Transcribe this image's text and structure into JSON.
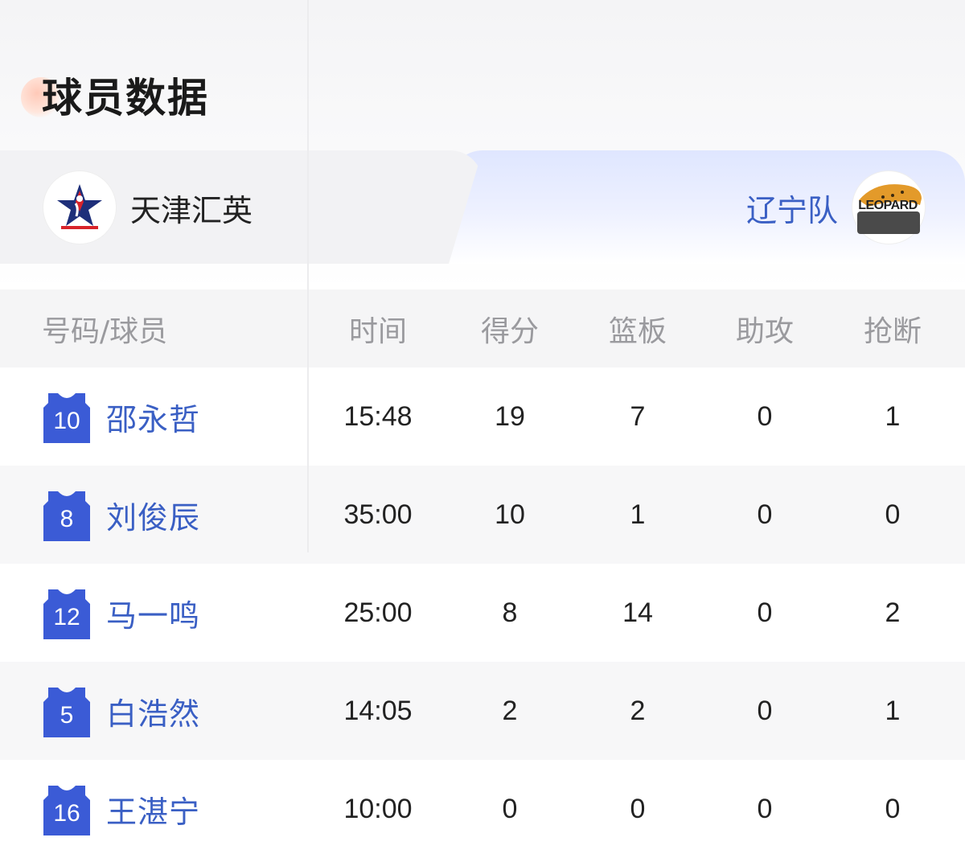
{
  "section": {
    "title": "球员数据"
  },
  "teams": {
    "home": {
      "name": "天津汇英",
      "logo_icon": "star-basketball-logo"
    },
    "away": {
      "name": "辽宁队",
      "logo_icon": "leopard-logo",
      "logo_text": "LEOPARD",
      "active": true
    }
  },
  "table": {
    "headers": {
      "player": "号码/球员",
      "time": "时间",
      "points": "得分",
      "rebounds": "篮板",
      "assists": "助攻",
      "steals": "抢断"
    },
    "rows": [
      {
        "number": "10",
        "name": "邵永哲",
        "time": "15:48",
        "points": "19",
        "rebounds": "7",
        "assists": "0",
        "steals": "1"
      },
      {
        "number": "8",
        "name": "刘俊辰",
        "time": "35:00",
        "points": "10",
        "rebounds": "1",
        "assists": "0",
        "steals": "0"
      },
      {
        "number": "12",
        "name": "马一鸣",
        "time": "25:00",
        "points": "8",
        "rebounds": "14",
        "assists": "0",
        "steals": "2"
      },
      {
        "number": "5",
        "name": "白浩然",
        "time": "14:05",
        "points": "2",
        "rebounds": "2",
        "assists": "0",
        "steals": "1"
      },
      {
        "number": "16",
        "name": "王湛宁",
        "time": "10:00",
        "points": "0",
        "rebounds": "0",
        "assists": "0",
        "steals": "0"
      }
    ]
  },
  "colors": {
    "accent": "#3a5fc4",
    "jersey": "#3b5bd6",
    "header_text": "#9a9a9e"
  }
}
